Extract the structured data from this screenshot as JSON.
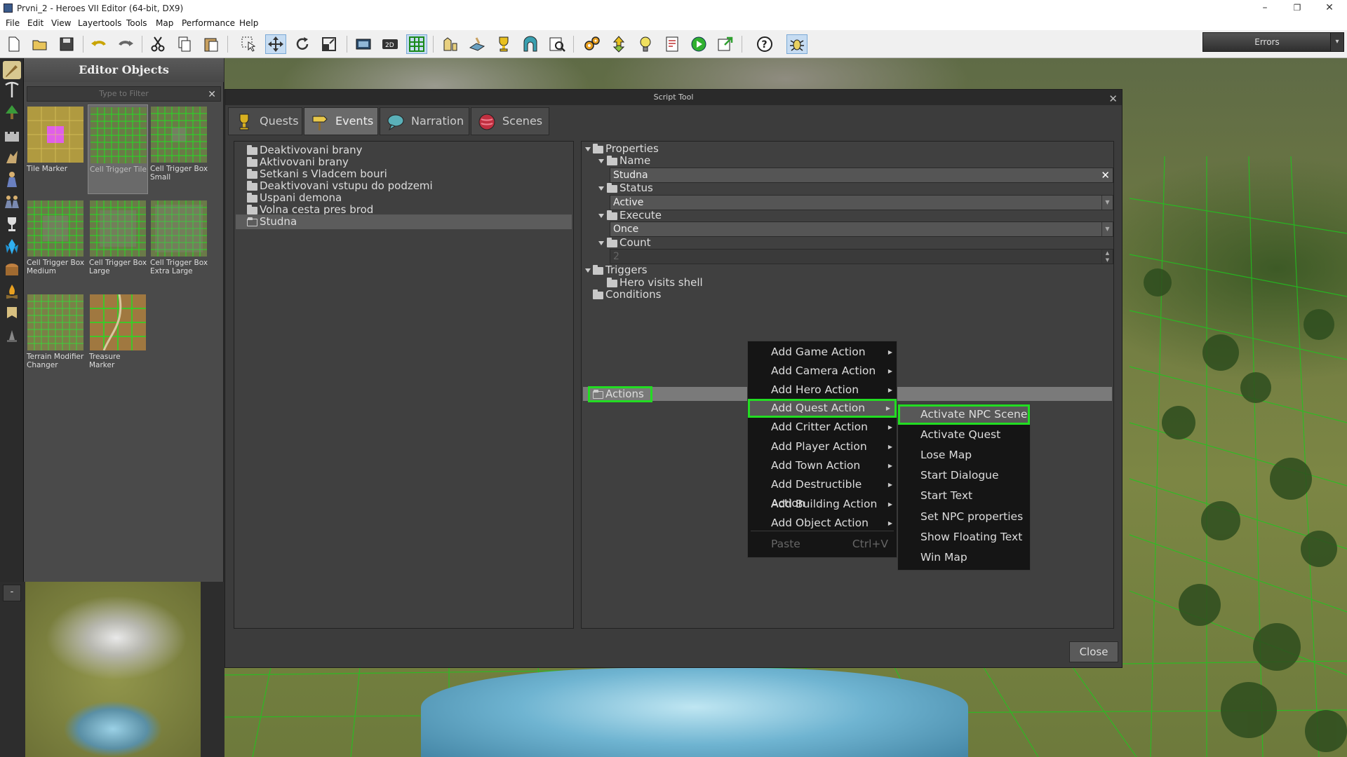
{
  "window": {
    "title": "Prvni_2 - Heroes VII Editor (64-bit, DX9)"
  },
  "menubar": [
    "File",
    "Edit",
    "View",
    "Layertools",
    "Tools",
    "Map",
    "Performance",
    "Help"
  ],
  "toolbar": {
    "errors_label": "Errors"
  },
  "editor_objects": {
    "title": "Editor Objects",
    "filter_placeholder": "Type to Filter",
    "items": [
      {
        "label": "Tile Marker"
      },
      {
        "label": "Cell Trigger Tile",
        "selected": true
      },
      {
        "label": "Cell Trigger Box Small"
      },
      {
        "label": "Cell Trigger Box Medium"
      },
      {
        "label": "Cell Trigger Box Large"
      },
      {
        "label": "Cell Trigger Box Extra Large"
      },
      {
        "label": "Terrain Modifier Changer"
      },
      {
        "label": "Treasure Marker"
      }
    ]
  },
  "minimap": {
    "toggle_label": "-"
  },
  "script_tool": {
    "title": "Script Tool",
    "tabs": [
      "Quests",
      "Events",
      "Narration",
      "Scenes"
    ],
    "active_tab": "Events",
    "events": [
      "Deaktivovani brany",
      "Aktivovani brany",
      "Setkani s Vladcem bouri",
      "Deaktivovani vstupu do podzemi",
      "Uspani demona",
      "Volna cesta pres brod",
      "Studna"
    ],
    "selected_event": "Studna",
    "properties": {
      "root": "Properties",
      "name_label": "Name",
      "name_value": "Studna",
      "status_label": "Status",
      "status_value": "Active",
      "execute_label": "Execute",
      "execute_value": "Once",
      "count_label": "Count",
      "count_value": "2",
      "triggers_label": "Triggers",
      "trigger_item": "Hero visits shell",
      "conditions_label": "Conditions",
      "actions_label": "Actions"
    },
    "close_label": "Close"
  },
  "context_menu": {
    "items": [
      "Add Game Action",
      "Add Camera Action",
      "Add Hero Action",
      "Add Quest Action",
      "Add Critter Action",
      "Add Player Action",
      "Add Town Action",
      "Add Destructible Action",
      "Add Building Action",
      "Add Object Action"
    ],
    "highlighted": "Add Quest Action",
    "paste_label": "Paste",
    "paste_shortcut": "Ctrl+V"
  },
  "submenu": {
    "items": [
      "Activate NPC Scene",
      "Activate Quest",
      "Lose Map",
      "Start Dialogue",
      "Start Text",
      "Set NPC properties",
      "Show Floating Text",
      "Win Map"
    ],
    "highlighted": "Activate NPC Scene"
  },
  "colors": {
    "highlight": "#22dd22",
    "menu_bg": "#151515",
    "panel_bg": "#404040"
  }
}
